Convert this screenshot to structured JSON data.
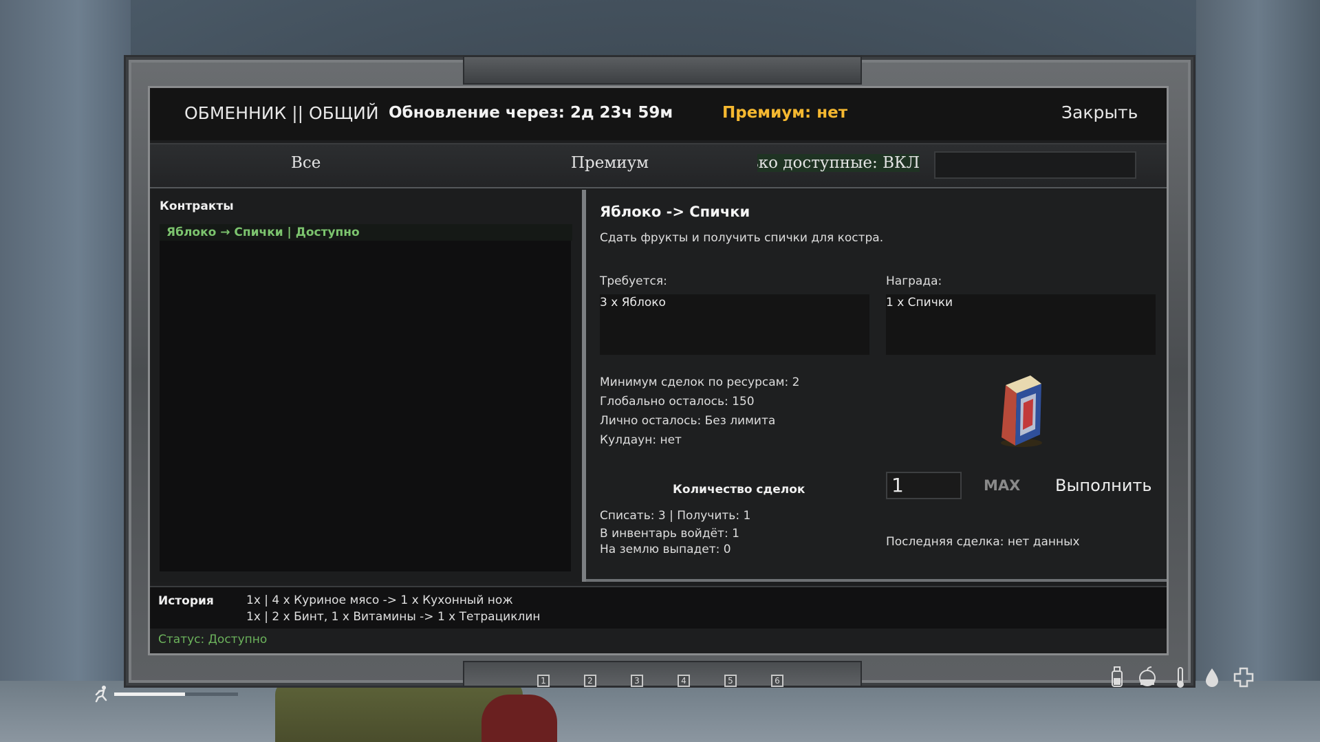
{
  "header": {
    "title": "ОБМЕННИК || ОБЩИЙ",
    "update": "Обновление через: 2д 23ч 59м",
    "premium": "Премиум: нет",
    "close": "Закрыть"
  },
  "filters": {
    "all": "Все",
    "premium": "Премиум",
    "available_only": "олько доступные: ВКЛ"
  },
  "contracts": {
    "label": "Контракты",
    "items": [
      {
        "text": "Яблоко → Спички | Доступно"
      }
    ]
  },
  "detail": {
    "title": "Яблоко -> Спички",
    "description": "Сдать фрукты и получить спички для костра.",
    "required_label": "Требуется:",
    "required_item": "3 x Яблоко",
    "reward_label": "Награда:",
    "reward_item": "1 x Спички",
    "min_deals": "Минимум сделок по ресурсам: 2",
    "global_left": "Глобально осталось: 150",
    "personal_left": "Лично осталось: Без лимита",
    "cooldown": "Кулдаун: нет",
    "qty_label": "Количество сделок",
    "qty_value": "1",
    "max": "MAX",
    "execute": "Выполнить",
    "write_off": "Списать: 3 | Получить: 1",
    "to_inventory": "В инвентарь войдёт: 1",
    "to_ground": "На землю выпадет: 0",
    "last_deal": "Последняя сделка: нет данных"
  },
  "history": {
    "label": "История",
    "lines": [
      "1x | 4 x Куриное мясо -> 1 x Кухонный нож",
      "1x | 2 x Бинт, 1 x Витамины -> 1 x Тетрациклин"
    ]
  },
  "status": "Статус: Доступно",
  "hotbar": [
    "1",
    "2",
    "3",
    "4",
    "5",
    "6"
  ],
  "stamina": {
    "fraction": 0.57
  },
  "status_icons": [
    "bottle-icon",
    "food-icon",
    "thermometer-icon",
    "water-drop-icon",
    "health-cross-icon"
  ],
  "colors": {
    "premium": "#f5b830",
    "available": "#7cc46e",
    "status": "#6cb35c"
  }
}
